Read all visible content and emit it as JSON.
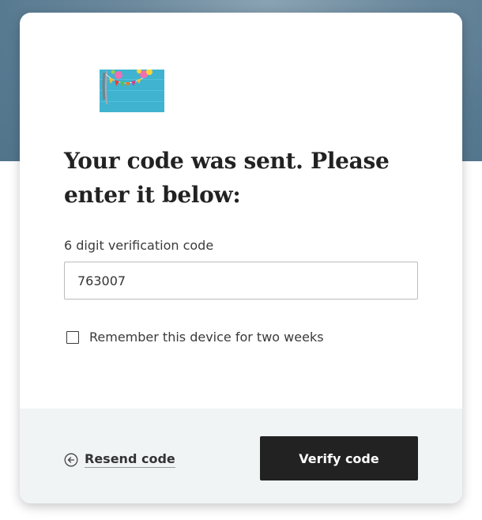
{
  "logo": {
    "icon": "party-bunting-logo-icon"
  },
  "heading": "Your code was sent. Please enter it below:",
  "code_field": {
    "label": "6 digit verification code",
    "value": "763007"
  },
  "remember": {
    "label": "Remember this device for two weeks",
    "checked": false
  },
  "actions": {
    "resend_label": "Resend code",
    "resend_icon": "arrow-left-circle-icon",
    "verify_label": "Verify code"
  },
  "colors": {
    "button_bg": "#222222",
    "footer_bg": "#f1f4f5",
    "backdrop": "#587a91"
  }
}
